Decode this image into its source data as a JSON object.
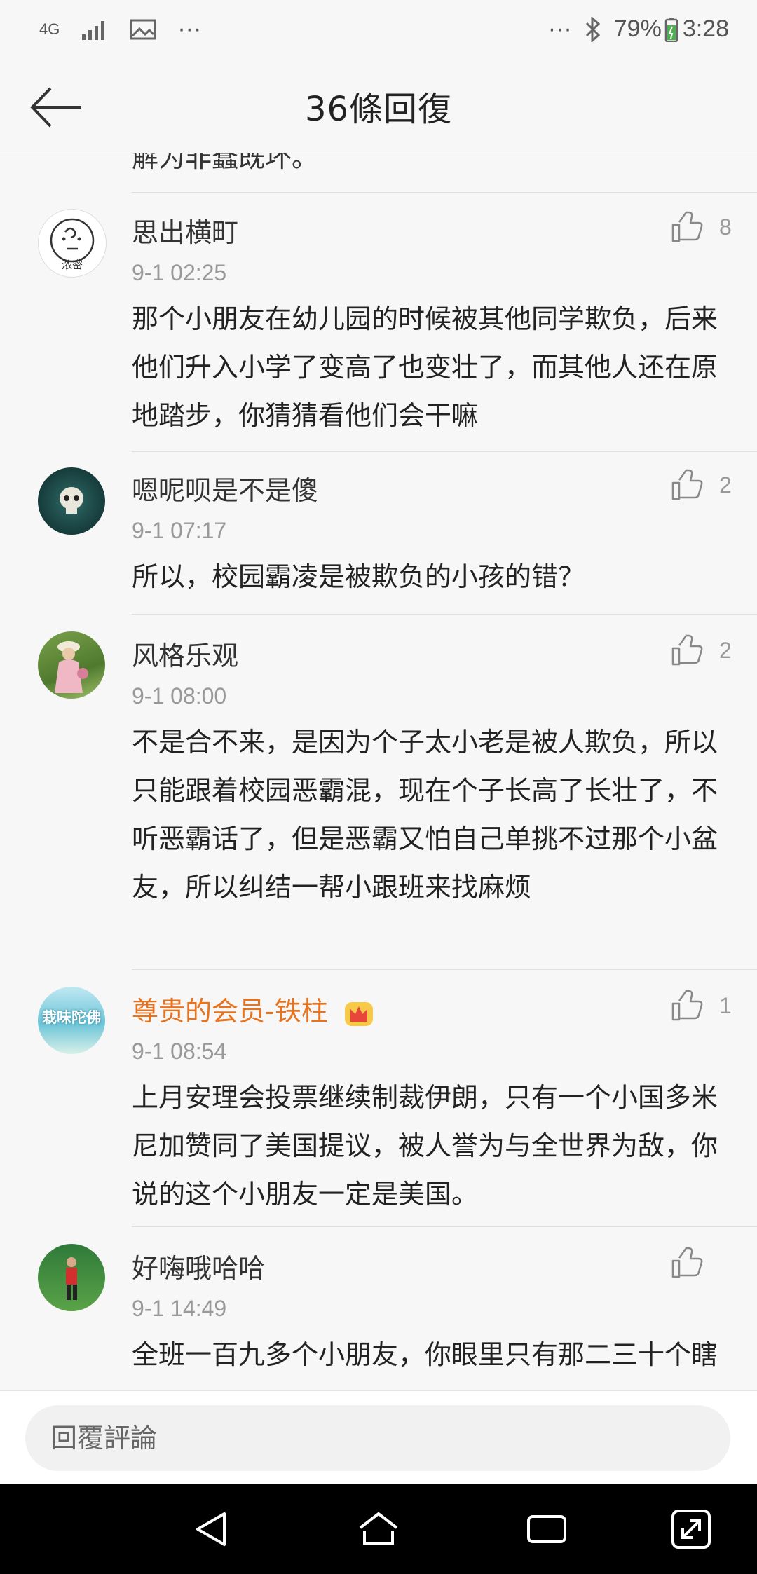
{
  "status_bar": {
    "network": "4G",
    "battery": "79%",
    "time": "3:28",
    "dots": "···"
  },
  "header": {
    "title": "36條回復"
  },
  "prev_tail": "解为非蠢既坏。",
  "comments": [
    {
      "name": "思出横町",
      "time": "9-1 02:25",
      "likes": "8",
      "text": "那个小朋友在幼儿园的时候被其他同学欺负，后来他们升入小学了变高了也变壮了，而其他人还在原地踏步，你猜猜看他们会干嘛",
      "avatar_label": "浓密",
      "vip": false
    },
    {
      "name": "嗯呢呗是不是傻",
      "time": "9-1 07:17",
      "likes": "2",
      "text": "所以，校园霸凌是被欺负的小孩的错？",
      "vip": false
    },
    {
      "name": "风格乐观",
      "time": "9-1 08:00",
      "likes": "2",
      "text": "不是合不来，是因为个子太小老是被人欺负，所以只能跟着校园恶霸混，现在个子长高了长壮了，不听恶霸话了，但是恶霸又怕自己单挑不过那个小盆友，所以纠结一帮小跟班来找麻烦",
      "vip": false
    },
    {
      "name": "尊贵的会员-铁柱",
      "time": "9-1 08:54",
      "likes": "1",
      "text": "上月安理会投票继续制裁伊朗，只有一个小国多米尼加赞同了美国提议，被人誉为与全世界为敌，你说的这个小朋友一定是美国。",
      "avatar_label": "栽味陀佛",
      "vip": true
    },
    {
      "name": "好嗨哦哈哈",
      "time": "9-1 14:49",
      "likes": "",
      "text": "全班一百九多个小朋友，你眼里只有那二三十个瞎子吗",
      "vip": false
    }
  ],
  "reply": {
    "placeholder": "回覆評論"
  },
  "colors": {
    "background": "#f7f7f7",
    "vip_name": "#e8731f",
    "muted": "#999999"
  }
}
